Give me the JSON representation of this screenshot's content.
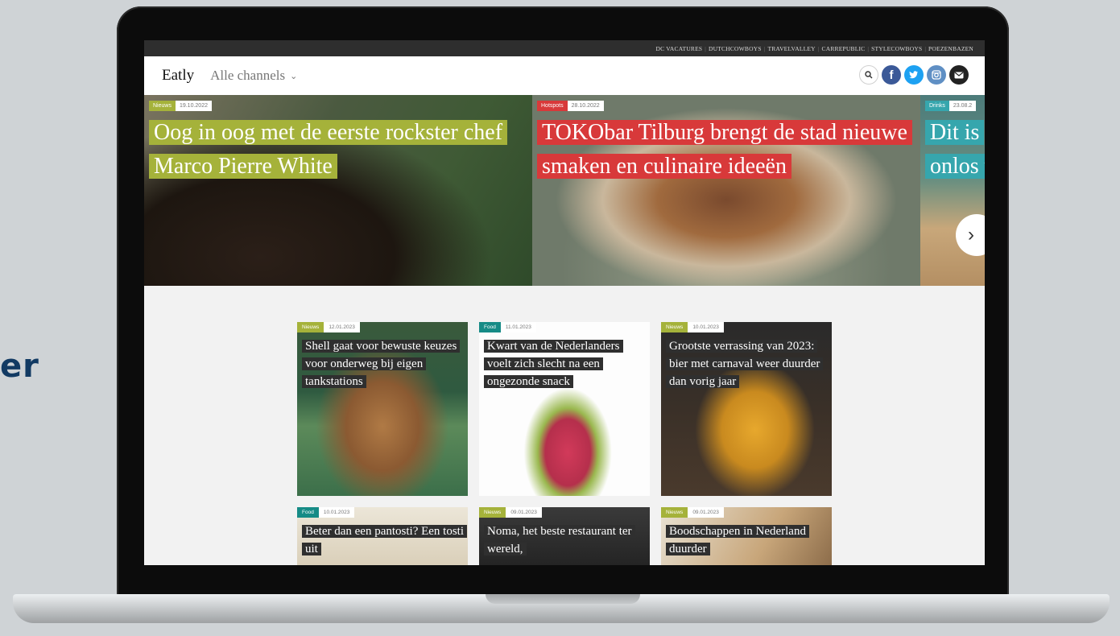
{
  "side_text": "er",
  "top_links": [
    "DC VACATURES",
    "DUTCHCOWBOYS",
    "TRAVELVALLEY",
    "CARREPUBLIC",
    "STYLECOWBOYS",
    "POEZENBAZEN"
  ],
  "nav": {
    "brand": "Eatly",
    "channels": "Alle channels"
  },
  "icons": {
    "search": "search-icon",
    "facebook": "facebook-icon",
    "twitter": "twitter-icon",
    "instagram": "instagram-icon",
    "mail": "mail-icon",
    "next": "chevron-right-icon"
  },
  "hero": [
    {
      "tag": "Nieuws",
      "date": "19.10.2022",
      "title": "Oog in oog met de eerste rockster chef Marco Pierre White",
      "color": "#a5b23a"
    },
    {
      "tag": "Hotspots",
      "date": "28.10.2022",
      "title": "TOKObar Tilburg brengt de stad nieuwe smaken en culinaire ideeën",
      "color": "#d8393a"
    },
    {
      "tag": "Drinks",
      "date": "23.08.2",
      "title": "Dit is onlos ver",
      "color": "#36a6ad"
    }
  ],
  "articles": [
    {
      "tag": "Nieuws",
      "date": "12.01.2023",
      "title": "Shell gaat voor bewuste keuzes voor onderweg bij eigen tankstations"
    },
    {
      "tag": "Food",
      "date": "11.01.2023",
      "title": "Kwart van de Nederlanders voelt zich slecht na een ongezonde snack"
    },
    {
      "tag": "Nieuws",
      "date": "10.01.2023",
      "title": "Grootste verrassing van 2023: bier met carnaval weer duurder dan vorig jaar"
    },
    {
      "tag": "Food",
      "date": "10.01.2023",
      "title": "Beter dan een pantosti? Een tosti uit"
    },
    {
      "tag": "Nieuws",
      "date": "09.01.2023",
      "title": "Noma, het beste restaurant ter wereld,"
    },
    {
      "tag": "Nieuws",
      "date": "09.01.2023",
      "title": "Boodschappen in Nederland duurder"
    }
  ]
}
